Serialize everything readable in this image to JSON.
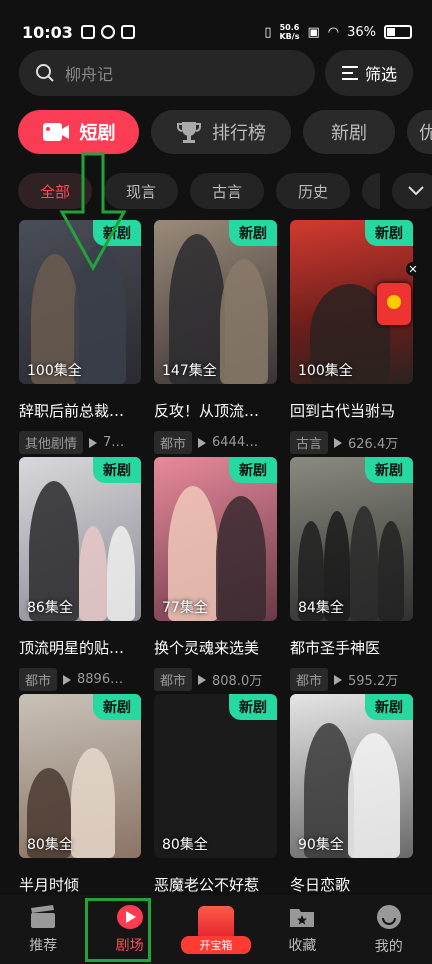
{
  "status_bar": {
    "time": "10:03",
    "net_speed_top": "50.6",
    "net_speed_bottom": "KB/s",
    "battery": "36%"
  },
  "search": {
    "placeholder": "柳舟记",
    "filter_label": "筛选"
  },
  "main_tabs": [
    {
      "label": "短剧"
    },
    {
      "label": "排行榜"
    },
    {
      "label": "新剧"
    },
    {
      "label": "优"
    }
  ],
  "sub_tabs": [
    {
      "label": "全部"
    },
    {
      "label": "现言"
    },
    {
      "label": "古言"
    },
    {
      "label": "历史"
    }
  ],
  "cards": [
    {
      "title": "辞职后前总裁…",
      "episodes": "100集全",
      "badge": "新剧",
      "tag": "其他剧情",
      "views": "7…",
      "colors": [
        "#3b3f4a",
        "#6b5c50"
      ]
    },
    {
      "title": "反攻！从顶流…",
      "episodes": "147集全",
      "badge": "新剧",
      "tag": "都市",
      "views": "6444…",
      "colors": [
        "#8a7a6a",
        "#2a2a2e"
      ]
    },
    {
      "title": "回到古代当驸马",
      "episodes": "100集全",
      "badge": "新剧",
      "tag": "古言",
      "views": "626.4万",
      "colors": [
        "#c9342c",
        "#2b2220"
      ]
    },
    {
      "title": "顶流明星的贴…",
      "episodes": "86集全",
      "badge": "新剧",
      "tag": "都市",
      "views": "8896…",
      "colors": [
        "#c8c8cc",
        "#2a2a2e"
      ]
    },
    {
      "title": "换个灵魂来选美",
      "episodes": "77集全",
      "badge": "新剧",
      "tag": "都市",
      "views": "808.0万",
      "colors": [
        "#d77f90",
        "#6a3a4a"
      ]
    },
    {
      "title": "都市圣手神医",
      "episodes": "84集全",
      "badge": "新剧",
      "tag": "都市",
      "views": "595.2万",
      "colors": [
        "#7a7a70",
        "#202020"
      ]
    },
    {
      "title": "半月时倾",
      "episodes": "80集全",
      "badge": "新剧",
      "tag": "",
      "views": "",
      "colors": [
        "#b8b2a8",
        "#5a4238"
      ]
    },
    {
      "title": "恶魔老公不好惹",
      "episodes": "80集全",
      "badge": "新剧",
      "tag": "",
      "views": "",
      "colors": [
        "#1b1b1b",
        "#1b1b1b"
      ]
    },
    {
      "title": "冬日恋歌",
      "episodes": "90集全",
      "badge": "新剧",
      "tag": "",
      "views": "",
      "colors": [
        "#dcdcdc",
        "#3a3a3a"
      ]
    }
  ],
  "bottom_nav": [
    {
      "label": "推荐"
    },
    {
      "label": "剧场"
    },
    {
      "label": "开宝箱"
    },
    {
      "label": "收藏"
    },
    {
      "label": "我的"
    }
  ]
}
